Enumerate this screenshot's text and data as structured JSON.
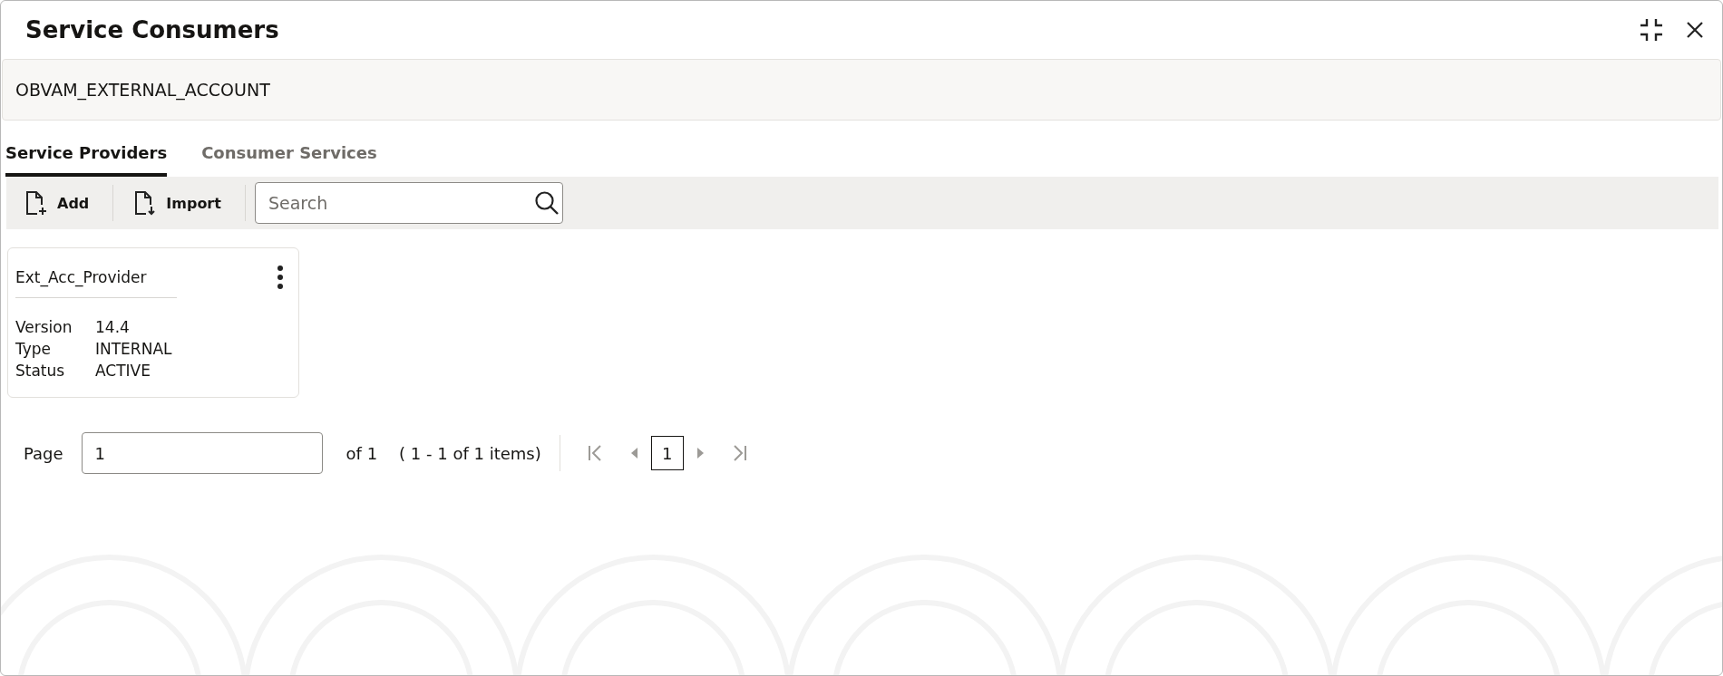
{
  "window": {
    "title": "Service Consumers"
  },
  "header": {
    "name": "OBVAM_EXTERNAL_ACCOUNT"
  },
  "tabs": [
    {
      "label": "Service Providers",
      "selected": true
    },
    {
      "label": "Consumer Services",
      "selected": false
    }
  ],
  "toolbar": {
    "buttons": [
      {
        "label": "Add",
        "kind": "add"
      },
      {
        "label": "Import",
        "kind": "import"
      }
    ],
    "search": {
      "placeholder": "Search"
    }
  },
  "cards": [
    {
      "title": "Ext_Acc_Provider",
      "fields": [
        {
          "label": "Version",
          "value": "14.4"
        },
        {
          "label": "Type",
          "value": "INTERNAL"
        },
        {
          "label": "Status",
          "value": "ACTIVE"
        }
      ]
    }
  ],
  "pagination": {
    "label": "Page",
    "value": "1",
    "of": "of 1",
    "summary": "( 1 - 1 of 1 items)",
    "nav": [
      {
        "kind": "first",
        "disabled": true
      },
      {
        "kind": "prev",
        "disabled": true
      },
      {
        "kind": "page",
        "label": "1",
        "selected": true
      },
      {
        "kind": "next",
        "disabled": true
      },
      {
        "kind": "last",
        "disabled": true
      }
    ]
  }
}
